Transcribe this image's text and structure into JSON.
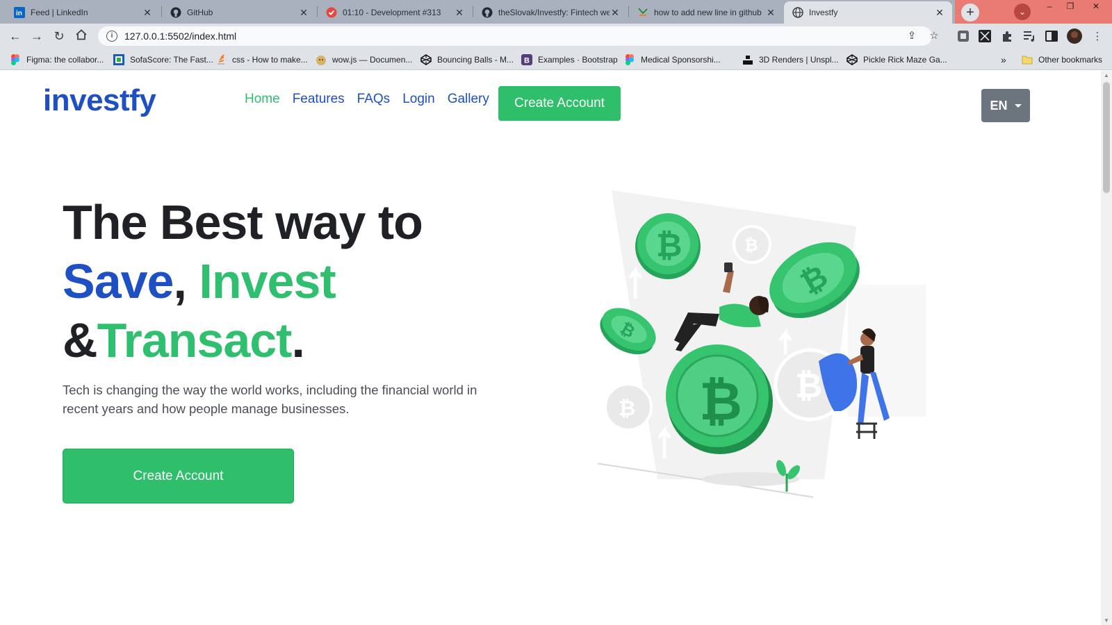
{
  "browser": {
    "tabs": [
      {
        "title": "Feed | LinkedIn",
        "icon": "linkedin-icon"
      },
      {
        "title": "GitHub",
        "icon": "github-icon"
      },
      {
        "title": "01:10 - Development #313",
        "icon": "timer-icon"
      },
      {
        "title": "theSlovak/Investfy: Fintech web",
        "icon": "github-icon"
      },
      {
        "title": "how to add new line in github",
        "icon": "stackoverflow-icon"
      },
      {
        "title": "Investfy",
        "icon": "globe-icon",
        "active": true
      }
    ],
    "url": "127.0.0.1:5502/index.html",
    "bookmarks": [
      {
        "label": "Figma: the collabor...",
        "icon": "figma-icon"
      },
      {
        "label": "SofaScore: The Fast...",
        "icon": "sofascore-icon"
      },
      {
        "label": "css - How to make...",
        "icon": "stackoverflow-icon"
      },
      {
        "label": "wow.js — Documen...",
        "icon": "doge-icon"
      },
      {
        "label": "Bouncing Balls - M...",
        "icon": "codepen-icon"
      },
      {
        "label": "Examples · Bootstrap",
        "icon": "bootstrap-icon"
      },
      {
        "label": "Medical Sponsorshi...",
        "icon": "figma-icon"
      },
      {
        "label": "3D Renders | Unspl...",
        "icon": "unsplash-icon"
      },
      {
        "label": "Pickle Rick Maze Ga...",
        "icon": "codepen-icon"
      }
    ],
    "other_bookmarks": "Other bookmarks",
    "more_bookmarks": "»"
  },
  "site": {
    "logo": "investfy",
    "nav": [
      {
        "label": "Home",
        "active": true
      },
      {
        "label": "Features"
      },
      {
        "label": "FAQs"
      },
      {
        "label": "Login"
      },
      {
        "label": "Gallery"
      }
    ],
    "nav_cta": "Create Account",
    "language": "EN"
  },
  "hero": {
    "line1": "The Best way to",
    "save": "Save",
    "comma": ",",
    "invest": "Invest",
    "amp": "&",
    "transact": "Transact",
    "period": ".",
    "description": "Tech is changing the way the world works, including the financial world in recent years and how people manage businesses.",
    "cta": "Create Account"
  },
  "colors": {
    "brand_blue": "#1e4fc3",
    "brand_green": "#2fbf6f",
    "dark": "#1f2126",
    "gray_button": "#6c757d"
  }
}
